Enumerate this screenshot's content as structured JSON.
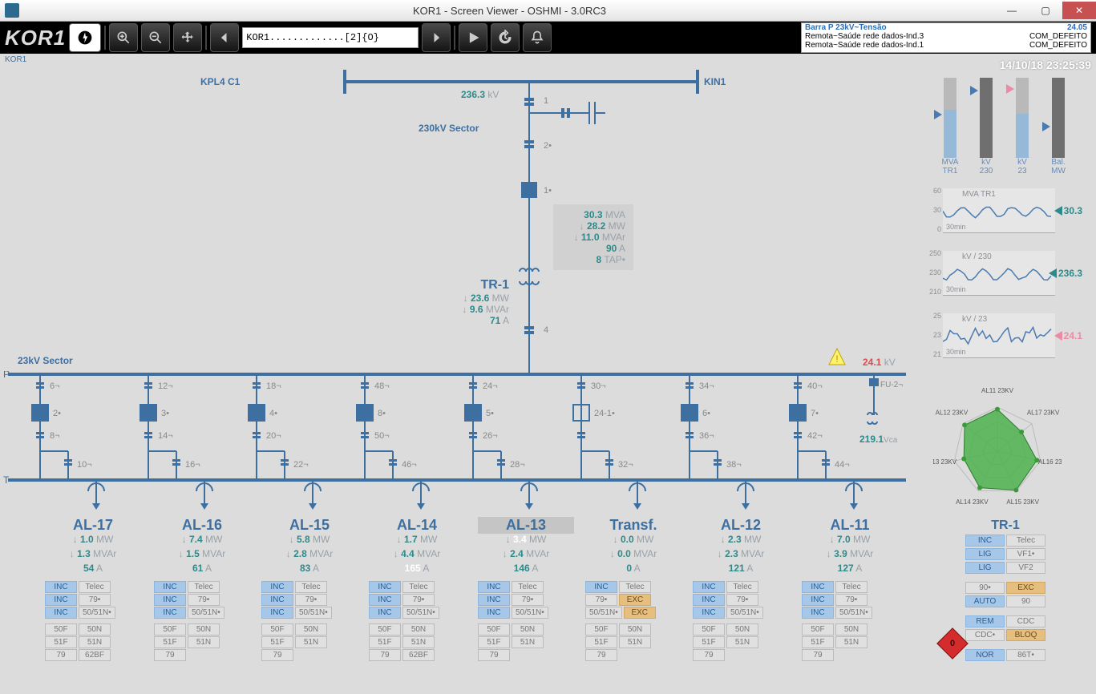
{
  "window": {
    "title": "KOR1 - Screen Viewer - OSHMI - 3.0RC3"
  },
  "toolbar": {
    "station": "KOR1",
    "dropdown": "KOR1.............[2]{O}"
  },
  "alarms": [
    {
      "a": "Barra P 23kV~Tensão",
      "b": "24.05",
      "hl": true
    },
    {
      "a": "Remota~Saúde rede dados-Ind.3",
      "b": "COM_DEFEITO"
    },
    {
      "a": "Remota~Saúde rede dados-Ind.1",
      "b": "COM_DEFEITO"
    }
  ],
  "top": {
    "kpl4": "KPL4 C1",
    "kin1": "KIN1",
    "kv230": "236.3",
    "kv230u": "kV",
    "sector230": "230kV Sector",
    "tr1": {
      "name": "TR-1",
      "mw": "23.6",
      "mvar": "9.6",
      "a": "71"
    },
    "tr1box": {
      "mva": "30.3",
      "mw": "28.2",
      "mvar": "11.0",
      "a": "90",
      "tap": "8"
    }
  },
  "bus23": {
    "label": "23kV Sector",
    "kv": "24.1",
    "kvUnit": "kV",
    "vca": "219.1",
    "vcaUnit": "Vca"
  },
  "clock": "14/10/18 23:25:39",
  "disc": {
    "top": [
      "6¬",
      "12¬",
      "18¬",
      "48¬",
      "24¬",
      "30¬",
      "34¬",
      "40¬"
    ],
    "brk": [
      "2•",
      "3•",
      "4•",
      "8•",
      "5•",
      "24-1•",
      "6•",
      "7•"
    ],
    "mid": [
      "8¬",
      "14¬",
      "20¬",
      "50¬",
      "26¬",
      "",
      "36¬",
      "42¬"
    ],
    "bot": [
      "10¬",
      "16¬",
      "22¬",
      "46¬",
      "28¬",
      "32¬",
      "38¬",
      "44¬"
    ]
  },
  "feeders": [
    {
      "name": "AL-17",
      "mw": "1.0",
      "mvar": "1.3",
      "a": "54",
      "hot": false,
      "tags": [
        [
          "INC",
          "Telec",
          "blue",
          ""
        ],
        [
          "INC",
          "79•",
          "blue",
          ""
        ],
        [
          "INC",
          "50/51N•",
          "blue",
          ""
        ]
      ],
      "prot": [
        [
          "50F",
          "50N"
        ],
        [
          "51F",
          "51N"
        ],
        [
          "79",
          "62BF"
        ]
      ]
    },
    {
      "name": "AL-16",
      "mw": "7.4",
      "mvar": "1.5",
      "a": "61",
      "hot": false,
      "tags": [
        [
          "INC",
          "Telec",
          "blue",
          ""
        ],
        [
          "INC",
          "79•",
          "blue",
          ""
        ],
        [
          "INC",
          "50/51N•",
          "blue",
          ""
        ]
      ],
      "prot": [
        [
          "50F",
          "50N"
        ],
        [
          "51F",
          "51N"
        ],
        [
          "79",
          ""
        ]
      ]
    },
    {
      "name": "AL-15",
      "mw": "5.8",
      "mvar": "2.8",
      "a": "83",
      "hot": false,
      "tags": [
        [
          "INC",
          "Telec",
          "blue",
          ""
        ],
        [
          "INC",
          "79•",
          "blue",
          ""
        ],
        [
          "INC",
          "50/51N•",
          "blue",
          ""
        ]
      ],
      "prot": [
        [
          "50F",
          "50N"
        ],
        [
          "51F",
          "51N"
        ],
        [
          "79",
          ""
        ]
      ]
    },
    {
      "name": "AL-14",
      "mw": "1.7",
      "mvar": "4.4",
      "a": "165",
      "hot": false,
      "ahot": true,
      "tags": [
        [
          "INC",
          "Telec",
          "blue",
          ""
        ],
        [
          "INC",
          "79•",
          "blue",
          ""
        ],
        [
          "INC",
          "50/51N•",
          "blue",
          ""
        ]
      ],
      "prot": [
        [
          "50F",
          "50N"
        ],
        [
          "51F",
          "51N"
        ],
        [
          "79",
          "62BF"
        ]
      ]
    },
    {
      "name": "AL-13",
      "mw": "3.4",
      "mvar": "2.4",
      "a": "146",
      "hot": true,
      "tags": [
        [
          "INC",
          "Telec",
          "blue",
          ""
        ],
        [
          "INC",
          "79•",
          "blue",
          ""
        ],
        [
          "INC",
          "50/51N•",
          "blue",
          ""
        ]
      ],
      "prot": [
        [
          "50F",
          "50N"
        ],
        [
          "51F",
          "51N"
        ],
        [
          "79",
          ""
        ]
      ]
    },
    {
      "name": "Transf.",
      "mw": "0.0",
      "mvar": "0.0",
      "a": "0",
      "hot": false,
      "tags": [
        [
          "INC",
          "Telec",
          "blue",
          ""
        ],
        [
          "79•",
          "EXC",
          "",
          "or"
        ],
        [
          "50/51N•",
          "EXC",
          "",
          "or"
        ]
      ],
      "prot": [
        [
          "50F",
          "50N"
        ],
        [
          "51F",
          "51N"
        ],
        [
          "79",
          ""
        ]
      ]
    },
    {
      "name": "AL-12",
      "mw": "2.3",
      "mvar": "2.3",
      "a": "121",
      "hot": false,
      "tags": [
        [
          "INC",
          "Telec",
          "blue",
          ""
        ],
        [
          "INC",
          "79•",
          "blue",
          ""
        ],
        [
          "INC",
          "50/51N•",
          "blue",
          ""
        ]
      ],
      "prot": [
        [
          "50F",
          "50N"
        ],
        [
          "51F",
          "51N"
        ],
        [
          "79",
          ""
        ]
      ]
    },
    {
      "name": "AL-11",
      "mw": "7.0",
      "mvar": "3.9",
      "a": "127",
      "hot": false,
      "tags": [
        [
          "INC",
          "Telec",
          "blue",
          ""
        ],
        [
          "INC",
          "79•",
          "blue",
          ""
        ],
        [
          "INC",
          "50/51N•",
          "blue",
          ""
        ]
      ],
      "prot": [
        [
          "50F",
          "50N"
        ],
        [
          "51F",
          "51N"
        ],
        [
          "79",
          ""
        ]
      ]
    }
  ],
  "gauges": [
    {
      "cap1": "MVA",
      "cap2": "TR1",
      "fill": 60,
      "ptr": "blue",
      "ptrPos": 40
    },
    {
      "cap1": "kV",
      "cap2": "230",
      "fill": 0,
      "dark": true,
      "ptr": "blue",
      "ptrPos": 10
    },
    {
      "cap1": "kV",
      "cap2": "23",
      "fill": 55,
      "ptr": "pink",
      "ptrPos": 8
    },
    {
      "cap1": "Bal.",
      "cap2": "MW",
      "fill": 0,
      "dark": true,
      "ptr": "blue",
      "ptrPos": 55
    }
  ],
  "trends": [
    {
      "title": "MVA TR1",
      "value": "30.3",
      "color": "teal",
      "yTicks": [
        "60",
        "30",
        "0"
      ]
    },
    {
      "title": "kV / 230",
      "value": "236.3",
      "color": "teal",
      "yTicks": [
        "250",
        "230",
        "210"
      ]
    },
    {
      "title": "kV / 23",
      "value": "24.1",
      "color": "pink",
      "yTicks": [
        "25",
        "23",
        "21"
      ]
    }
  ],
  "radar": {
    "labels": [
      "AL11 23KV",
      "AL17 23KV",
      "AL16 23KV",
      "AL15 23KV",
      "AL14 23KV",
      "AL13 23KV",
      "AL12 23KV"
    ],
    "values": [
      0.95,
      0.7,
      0.92,
      0.98,
      0.92,
      0.78,
      0.95
    ]
  },
  "tr1panel": {
    "title": "TR-1",
    "rows": [
      [
        "INC",
        "Telec",
        "blue",
        ""
      ],
      [
        "LIG",
        "VF1•",
        "blue",
        ""
      ],
      [
        "LIG",
        "VF2",
        "blue",
        ""
      ],
      [
        "90•",
        "EXC",
        "",
        "or"
      ],
      [
        "AUTO",
        "90",
        "blue",
        ""
      ],
      [
        "REM",
        "CDC",
        "blue",
        ""
      ],
      [
        "CDC•",
        "BLOQ",
        "",
        "or"
      ],
      [
        "NOR",
        "86T•",
        "blue",
        ""
      ]
    ],
    "diamond": "0"
  }
}
